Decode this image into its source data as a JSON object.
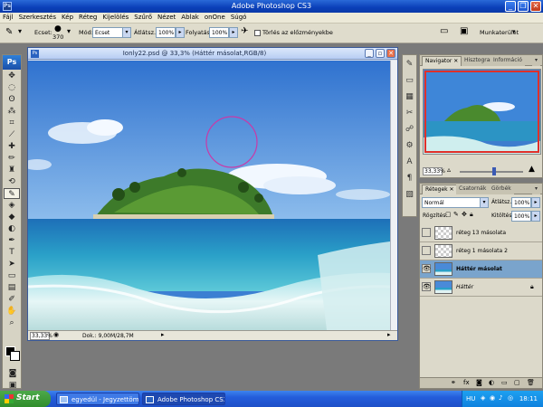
{
  "window": {
    "title": "Adobe Photoshop CS3",
    "app_icon": "Ps"
  },
  "menu": {
    "items": [
      "Fájl",
      "Szerkesztés",
      "Kép",
      "Réteg",
      "Kijelölés",
      "Szűrő",
      "Nézet",
      "Ablak",
      "onOne",
      "Súgó"
    ]
  },
  "options": {
    "brush_label": "Ecset:",
    "brush_size": "370",
    "mode_label": "Mód:",
    "mode_value": "Ecset",
    "opacity_label": "Átlátsz.:",
    "opacity_value": "100%",
    "flow_label": "Folyatás:",
    "flow_value": "100%",
    "erase_history_label": "Törlés az előzményekbe",
    "workspace_label": "Munkaterület"
  },
  "document": {
    "title": "Ionly22.psd @ 33,3% (Háttér másolat,RGB/8)",
    "zoom": "33,33%",
    "doc_size": "Dok.: 9,00M/28,7M",
    "ps_icon": "Ps"
  },
  "navigator": {
    "tabs": [
      "Navigator",
      "Hisztogram",
      "Információ"
    ],
    "zoom": "33,33%"
  },
  "layers": {
    "tabs": [
      "Rétegek",
      "Csatornák",
      "Görbék"
    ],
    "blend_mode": "Normál",
    "opacity_label": "Átlátsz.:",
    "opacity_value": "100%",
    "lock_label": "Rögzítés:",
    "fill_label": "Kitöltés:",
    "fill_value": "100%",
    "items": [
      {
        "name": "réteg 13 másolata",
        "visible": false,
        "selected": false
      },
      {
        "name": "réteg 1 másolata 2",
        "visible": false,
        "selected": false
      },
      {
        "name": "Háttér másolat",
        "visible": true,
        "selected": true
      },
      {
        "name": "Háttér",
        "visible": true,
        "selected": false,
        "locked": true
      }
    ]
  },
  "taskbar": {
    "start_label": "Start",
    "items": [
      {
        "label": "egyedül - Jegyzettömb",
        "active": false
      },
      {
        "label": "Adobe Photoshop CS3",
        "active": true
      }
    ],
    "lang": "HU",
    "clock": "18:11"
  },
  "colors": {
    "xp_blue": "#0a3fb8",
    "selected_layer": "#7aa4cc",
    "brush_cursor": "#c83aa8"
  }
}
